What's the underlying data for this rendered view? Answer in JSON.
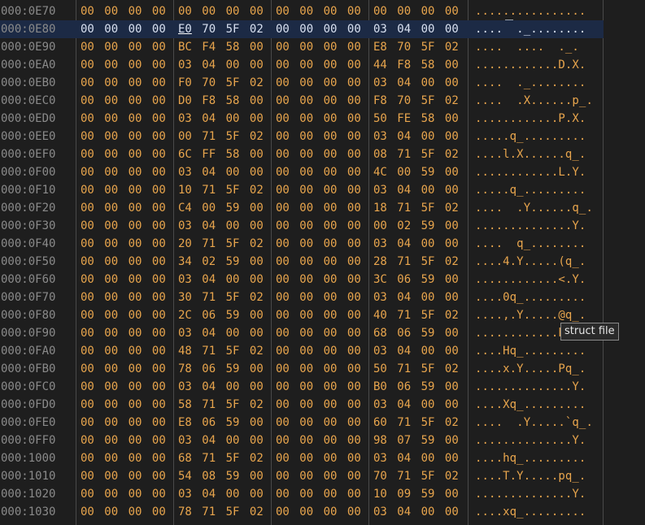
{
  "tooltip": "struct file",
  "selected_row": 1,
  "caret_byte": 4,
  "rows": [
    {
      "addr": "000:0E70",
      "hex": [
        "00",
        "00",
        "00",
        "00",
        "00",
        "00",
        "00",
        "00",
        "00",
        "00",
        "00",
        "00",
        "00",
        "00",
        "00",
        "00"
      ],
      "ascii": "................"
    },
    {
      "addr": "000:0E80",
      "hex": [
        "00",
        "00",
        "00",
        "00",
        "E0",
        "70",
        "5F",
        "02",
        "00",
        "00",
        "00",
        "00",
        "03",
        "04",
        "00",
        "00"
      ],
      "ascii": "....  ._........"
    },
    {
      "addr": "000:0E90",
      "hex": [
        "00",
        "00",
        "00",
        "00",
        "BC",
        "F4",
        "58",
        "00",
        "00",
        "00",
        "00",
        "00",
        "E8",
        "70",
        "5F",
        "02"
      ],
      "ascii": "....  ....  ._."
    },
    {
      "addr": "000:0EA0",
      "hex": [
        "00",
        "00",
        "00",
        "00",
        "03",
        "04",
        "00",
        "00",
        "00",
        "00",
        "00",
        "00",
        "44",
        "F8",
        "58",
        "00"
      ],
      "ascii": "............D.X."
    },
    {
      "addr": "000:0EB0",
      "hex": [
        "00",
        "00",
        "00",
        "00",
        "F0",
        "70",
        "5F",
        "02",
        "00",
        "00",
        "00",
        "00",
        "03",
        "04",
        "00",
        "00"
      ],
      "ascii": "....  ._........"
    },
    {
      "addr": "000:0EC0",
      "hex": [
        "00",
        "00",
        "00",
        "00",
        "D0",
        "F8",
        "58",
        "00",
        "00",
        "00",
        "00",
        "00",
        "F8",
        "70",
        "5F",
        "02"
      ],
      "ascii": "....  .X......p_."
    },
    {
      "addr": "000:0ED0",
      "hex": [
        "00",
        "00",
        "00",
        "00",
        "03",
        "04",
        "00",
        "00",
        "00",
        "00",
        "00",
        "00",
        "50",
        "FE",
        "58",
        "00"
      ],
      "ascii": "............P.X."
    },
    {
      "addr": "000:0EE0",
      "hex": [
        "00",
        "00",
        "00",
        "00",
        "00",
        "71",
        "5F",
        "02",
        "00",
        "00",
        "00",
        "00",
        "03",
        "04",
        "00",
        "00"
      ],
      "ascii": ".....q_........."
    },
    {
      "addr": "000:0EF0",
      "hex": [
        "00",
        "00",
        "00",
        "00",
        "6C",
        "FF",
        "58",
        "00",
        "00",
        "00",
        "00",
        "00",
        "08",
        "71",
        "5F",
        "02"
      ],
      "ascii": "....l.X......q_."
    },
    {
      "addr": "000:0F00",
      "hex": [
        "00",
        "00",
        "00",
        "00",
        "03",
        "04",
        "00",
        "00",
        "00",
        "00",
        "00",
        "00",
        "4C",
        "00",
        "59",
        "00"
      ],
      "ascii": "............L.Y."
    },
    {
      "addr": "000:0F10",
      "hex": [
        "00",
        "00",
        "00",
        "00",
        "10",
        "71",
        "5F",
        "02",
        "00",
        "00",
        "00",
        "00",
        "03",
        "04",
        "00",
        "00"
      ],
      "ascii": ".....q_........."
    },
    {
      "addr": "000:0F20",
      "hex": [
        "00",
        "00",
        "00",
        "00",
        "C4",
        "00",
        "59",
        "00",
        "00",
        "00",
        "00",
        "00",
        "18",
        "71",
        "5F",
        "02"
      ],
      "ascii": "....  .Y......q_."
    },
    {
      "addr": "000:0F30",
      "hex": [
        "00",
        "00",
        "00",
        "00",
        "03",
        "04",
        "00",
        "00",
        "00",
        "00",
        "00",
        "00",
        "00",
        "02",
        "59",
        "00"
      ],
      "ascii": "..............Y."
    },
    {
      "addr": "000:0F40",
      "hex": [
        "00",
        "00",
        "00",
        "00",
        "20",
        "71",
        "5F",
        "02",
        "00",
        "00",
        "00",
        "00",
        "03",
        "04",
        "00",
        "00"
      ],
      "ascii": "....  q_........"
    },
    {
      "addr": "000:0F50",
      "hex": [
        "00",
        "00",
        "00",
        "00",
        "34",
        "02",
        "59",
        "00",
        "00",
        "00",
        "00",
        "00",
        "28",
        "71",
        "5F",
        "02"
      ],
      "ascii": "....4.Y.....(q_."
    },
    {
      "addr": "000:0F60",
      "hex": [
        "00",
        "00",
        "00",
        "00",
        "03",
        "04",
        "00",
        "00",
        "00",
        "00",
        "00",
        "00",
        "3C",
        "06",
        "59",
        "00"
      ],
      "ascii": "............<.Y."
    },
    {
      "addr": "000:0F70",
      "hex": [
        "00",
        "00",
        "00",
        "00",
        "30",
        "71",
        "5F",
        "02",
        "00",
        "00",
        "00",
        "00",
        "03",
        "04",
        "00",
        "00"
      ],
      "ascii": "....0q_........."
    },
    {
      "addr": "000:0F80",
      "hex": [
        "00",
        "00",
        "00",
        "00",
        "2C",
        "06",
        "59",
        "00",
        "00",
        "00",
        "00",
        "00",
        "40",
        "71",
        "5F",
        "02"
      ],
      "ascii": "....,.Y.....@q_."
    },
    {
      "addr": "000:0F90",
      "hex": [
        "00",
        "00",
        "00",
        "00",
        "03",
        "04",
        "00",
        "00",
        "00",
        "00",
        "00",
        "00",
        "68",
        "06",
        "59",
        "00"
      ],
      "ascii": "............h.Y."
    },
    {
      "addr": "000:0FA0",
      "hex": [
        "00",
        "00",
        "00",
        "00",
        "48",
        "71",
        "5F",
        "02",
        "00",
        "00",
        "00",
        "00",
        "03",
        "04",
        "00",
        "00"
      ],
      "ascii": "....Hq_........."
    },
    {
      "addr": "000:0FB0",
      "hex": [
        "00",
        "00",
        "00",
        "00",
        "78",
        "06",
        "59",
        "00",
        "00",
        "00",
        "00",
        "00",
        "50",
        "71",
        "5F",
        "02"
      ],
      "ascii": "....x.Y.....Pq_."
    },
    {
      "addr": "000:0FC0",
      "hex": [
        "00",
        "00",
        "00",
        "00",
        "03",
        "04",
        "00",
        "00",
        "00",
        "00",
        "00",
        "00",
        "B0",
        "06",
        "59",
        "00"
      ],
      "ascii": "..............Y."
    },
    {
      "addr": "000:0FD0",
      "hex": [
        "00",
        "00",
        "00",
        "00",
        "58",
        "71",
        "5F",
        "02",
        "00",
        "00",
        "00",
        "00",
        "03",
        "04",
        "00",
        "00"
      ],
      "ascii": "....Xq_........."
    },
    {
      "addr": "000:0FE0",
      "hex": [
        "00",
        "00",
        "00",
        "00",
        "E8",
        "06",
        "59",
        "00",
        "00",
        "00",
        "00",
        "00",
        "60",
        "71",
        "5F",
        "02"
      ],
      "ascii": "....  .Y.....`q_."
    },
    {
      "addr": "000:0FF0",
      "hex": [
        "00",
        "00",
        "00",
        "00",
        "03",
        "04",
        "00",
        "00",
        "00",
        "00",
        "00",
        "00",
        "98",
        "07",
        "59",
        "00"
      ],
      "ascii": "..............Y."
    },
    {
      "addr": "000:1000",
      "hex": [
        "00",
        "00",
        "00",
        "00",
        "68",
        "71",
        "5F",
        "02",
        "00",
        "00",
        "00",
        "00",
        "03",
        "04",
        "00",
        "00"
      ],
      "ascii": "....hq_........."
    },
    {
      "addr": "000:1010",
      "hex": [
        "00",
        "00",
        "00",
        "00",
        "54",
        "08",
        "59",
        "00",
        "00",
        "00",
        "00",
        "00",
        "70",
        "71",
        "5F",
        "02"
      ],
      "ascii": "....T.Y.....pq_."
    },
    {
      "addr": "000:1020",
      "hex": [
        "00",
        "00",
        "00",
        "00",
        "03",
        "04",
        "00",
        "00",
        "00",
        "00",
        "00",
        "00",
        "10",
        "09",
        "59",
        "00"
      ],
      "ascii": "..............Y."
    },
    {
      "addr": "000:1030",
      "hex": [
        "00",
        "00",
        "00",
        "00",
        "78",
        "71",
        "5F",
        "02",
        "00",
        "00",
        "00",
        "00",
        "03",
        "04",
        "00",
        "00"
      ],
      "ascii": "....xq_........."
    }
  ]
}
